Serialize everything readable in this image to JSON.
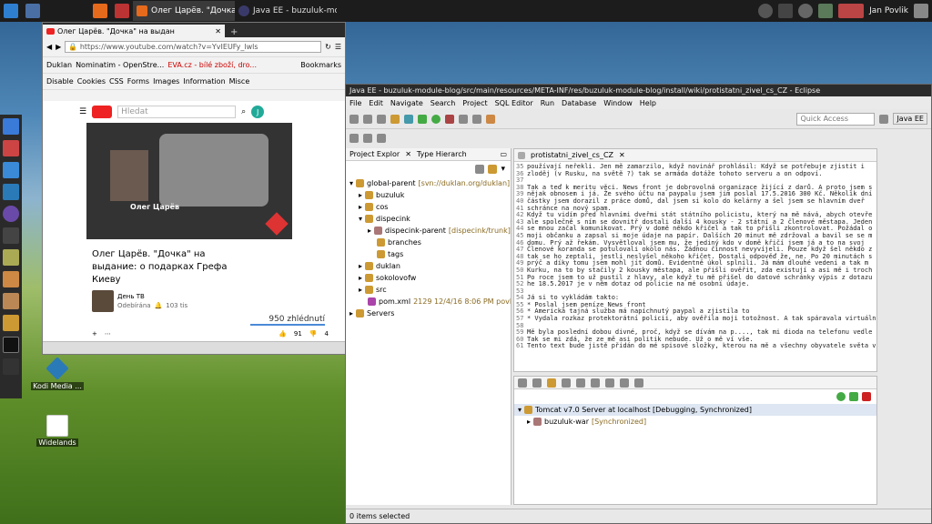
{
  "taskbar": {
    "windows": [
      {
        "label": "Олег Царёв. \"Дочка\" на ..."
      },
      {
        "label": "Java EE - buzuluk-modul..."
      }
    ],
    "user": "Jan Povlik"
  },
  "desktop": {
    "icons": [
      {
        "label": "Kodi Media ..."
      },
      {
        "label": "Widelands"
      }
    ]
  },
  "firefox": {
    "tab_title": "Олег Царёв. \"Дочка\" на выдан",
    "url": "https://www.youtube.com/watch?v=YvIEUFy_lwls",
    "bookmarks": [
      "Duklan",
      "Nominatim - OpenStre...",
      "EVA.cz - bílé zboží, dro...",
      "Bookmarks"
    ],
    "devtools": [
      "Disable",
      "Cookies",
      "CSS",
      "Forms",
      "Images",
      "Information",
      "Misce"
    ],
    "search_placeholder": "Hledat",
    "avatar_letter": "J",
    "video_caption_name": "Олег Царёв",
    "video_title": "Олег Царёв. \"Дочка\" на выдание: о подарках Грефа Киеву",
    "channel": "День ТВ",
    "subscribe": "Odebírána",
    "subscribers": "103 tis",
    "views": "950 zhlédnutí",
    "likes": "91",
    "dislikes": "4"
  },
  "eclipse": {
    "title": "Java EE - buzuluk-module-blog/src/main/resources/META-INF/res/buzuluk-module-blog/install/wiki/protistatni_zivel_cs_CZ - Eclipse",
    "menu": [
      "File",
      "Edit",
      "Navigate",
      "Search",
      "Project",
      "SQL Editor",
      "Run",
      "Database",
      "Window",
      "Help"
    ],
    "quick_access": "Quick Access",
    "perspective": "Java EE",
    "explorer_tab": "Project Explor",
    "hierarchy_tab": "Type Hierarch",
    "editor_tab": "protistatni_zivel_cs_CZ",
    "tree": [
      {
        "label": "global-parent",
        "suffix": "[svn://duklan.org/duklan]"
      },
      {
        "label": "buzuluk",
        "suffix": ""
      },
      {
        "label": "cos",
        "suffix": ""
      },
      {
        "label": "dispecink",
        "suffix": ""
      },
      {
        "label": "dispecink-parent",
        "suffix": "[dispecink/trunk]"
      },
      {
        "label": "branches",
        "suffix": ""
      },
      {
        "label": "tags",
        "suffix": ""
      },
      {
        "label": "duklan",
        "suffix": ""
      },
      {
        "label": "sokolovofw",
        "suffix": ""
      },
      {
        "label": "src",
        "suffix": ""
      },
      {
        "label": "pom.xml",
        "suffix": "2129 12/4/16 8:06 PM povlik3"
      },
      {
        "label": "Servers",
        "suffix": ""
      }
    ],
    "code_lines": [
      {
        "n": "35",
        "t": "používají neřekli. Jen mě zamarzilo, když novinář prohlásil: Když se potřebuje zjistit i"
      },
      {
        "n": "36",
        "t": "zloděj (v Rusku, na světě ?) tak se armáda dotáže tohoto serveru a on odpoví."
      },
      {
        "n": "37",
        "t": ""
      },
      {
        "n": "38",
        "t": "Tak a teď k meritu věci. News front je dobrovolná organizace žijící z darů. A proto jsem s"
      },
      {
        "n": "39",
        "t": "nějak obnosem i já. Že svého účtu na paypalu jsem jim poslal 17.5.2016 300 Kč. Několik dní"
      },
      {
        "n": "40",
        "t": "částky jsem dorazil z práce domů, dal jsem si kolo do kelárny a šel jsem se hlavním dveř"
      },
      {
        "n": "41",
        "t": "schránce na nový spam."
      },
      {
        "n": "42",
        "t": "Když tu vidím před hlavními dveřmi stát státního policistu, který na mě nává, abych otevře"
      },
      {
        "n": "43",
        "t": "ale společně s ním se dovnitř dostali další 4 kousky - 2 státní a 2 členové městapa. Jeden"
      },
      {
        "n": "44",
        "t": "se mnou začal komunikovat. Prý v domě někdo křičel a tak to přišli zkontrolovat. Požádal o"
      },
      {
        "n": "45",
        "t": "moji občanku a zapsal si moje údaje na papír. Dalších 20 minut mě zdržoval a bavil se se m"
      },
      {
        "n": "46",
        "t": "domu. Prý až řekám. Vysvětloval jsem mu, že jediný kdo v domě křičí jsem já a to na svoj"
      },
      {
        "n": "47",
        "t": "Členové koranda se potulovali okolo nás. Žádnou činnost nevyvíjeli. Pouze když šel někdo z"
      },
      {
        "n": "48",
        "t": "tak se ho zeptali, jestli neslyšel někoho křičet. Dostali odpověď že, ne. Po 20 minutách s"
      },
      {
        "n": "49",
        "t": "prýč a díky tomu jsem mohl jít domů. Evidentně úkol splnili. Já mám dlouhé vedení a tak m"
      },
      {
        "n": "50",
        "t": "Kurku, na to by stačily 2 kousky městapa, ale přišli ověřit, zda existují a asi mě i troch"
      },
      {
        "n": "51",
        "t": "Po roce jsem to už pustil z hlavy, ale když tu mě přišel do datové schránky výpis z dotazu"
      },
      {
        "n": "52",
        "t": "he 18.5.2017 je v něm dotaz od policie na mé osobní údaje."
      },
      {
        "n": "53",
        "t": ""
      },
      {
        "n": "54",
        "t": "Já si to vykládám takto:"
      },
      {
        "n": "55",
        "t": "* Poslal jsem peníze News front"
      },
      {
        "n": "56",
        "t": "* Americká tajná služba má napíchnutý paypal a zjistila to"
      },
      {
        "n": "57",
        "t": "* Vydala rozkaz protektorátní policii, aby ověřila moji totožnost. A tak spáravala virtuáln"
      },
      {
        "n": "58",
        "t": ""
      },
      {
        "n": "59",
        "t": "Mě byla poslední dobou divné, proč, když se dívám na p...., tak mi dioda na telefonu vedle"
      },
      {
        "n": "60",
        "t": "Tak se mi zdá, že ze mě asi politik nebude. Už o mě ví vše."
      },
      {
        "n": "61",
        "t": "Tento text bude jistě přidán do mé spisové složky, kterou na mě a všechny obyvatele světa v"
      }
    ],
    "servers_line": "Tomcat v7.0 Server at localhost  [Debugging, Synchronized]",
    "servers_child": "buzuluk-war",
    "servers_child_suffix": "[Synchronized]",
    "status": "0 items selected"
  }
}
